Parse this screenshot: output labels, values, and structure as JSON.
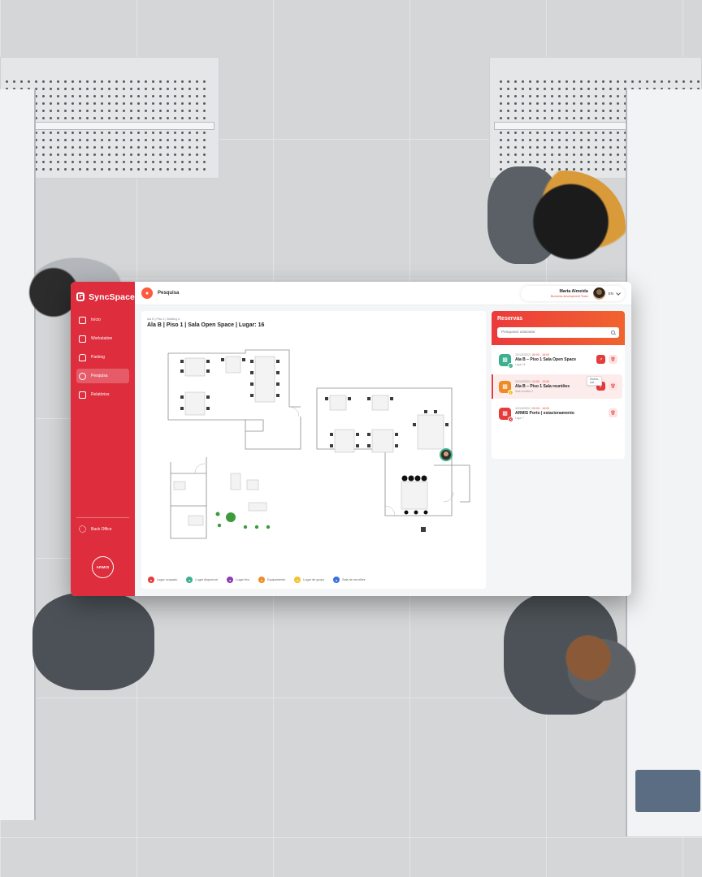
{
  "app": {
    "brand": "SyncSpace",
    "org_logo_text": "ARMIS"
  },
  "sidebar": {
    "items": [
      {
        "label": "Início",
        "icon": "layout-icon"
      },
      {
        "label": "Workstation",
        "icon": "desk-icon"
      },
      {
        "label": "Parking",
        "icon": "car-icon"
      },
      {
        "label": "Pesquisa",
        "icon": "person-search-icon",
        "active": true
      },
      {
        "label": "Relatórios",
        "icon": "report-icon"
      }
    ],
    "backoffice": "Back Office"
  },
  "header": {
    "title": "Pesquisa",
    "user_name": "Marta Almeida",
    "user_role": "Business development Team",
    "language": "EN"
  },
  "map": {
    "breadcrumb": "Ala B | Piso 1 | Building A",
    "title": "Ala B | Piso 1 | Sala Open Space | Lugar: 16",
    "legend": [
      {
        "label": "Lugar ocupado",
        "color": "#e53b3b"
      },
      {
        "label": "Lugar disponível",
        "color": "#3bb08f"
      },
      {
        "label": "Lugar fixo",
        "color": "#8e3bb5"
      },
      {
        "label": "Equipamento",
        "color": "#f08a24"
      },
      {
        "label": "Lugar de grupo",
        "color": "#f2c12e"
      },
      {
        "label": "Sala de reuniões",
        "color": "#3b6fe0"
      }
    ]
  },
  "reservations": {
    "title": "Reservas",
    "search_placeholder": "Pesquisar utilizador",
    "close_tooltip": "Check-out",
    "items": [
      {
        "date": "12/12/2022",
        "time": "09:00 - 18:00",
        "name": "Ala B – Piso 1 Sala Open Space",
        "sub": "Lugar 16",
        "color": "#3bb08f",
        "badge": "✓"
      },
      {
        "date": "12/12/2022",
        "time": "12:00 - 13:00",
        "name": "Ala B – Piso 1 Sala reuniões",
        "sub": "Sala reuniões 1",
        "color": "#f08a24",
        "badge": "!"
      },
      {
        "date": "12/12/2022",
        "time": "09:00 - 18:00",
        "name": "ARMIS Porto | estacionamento",
        "sub": "Lugar 7",
        "color": "#e53b3b",
        "badge": "✕"
      }
    ]
  }
}
